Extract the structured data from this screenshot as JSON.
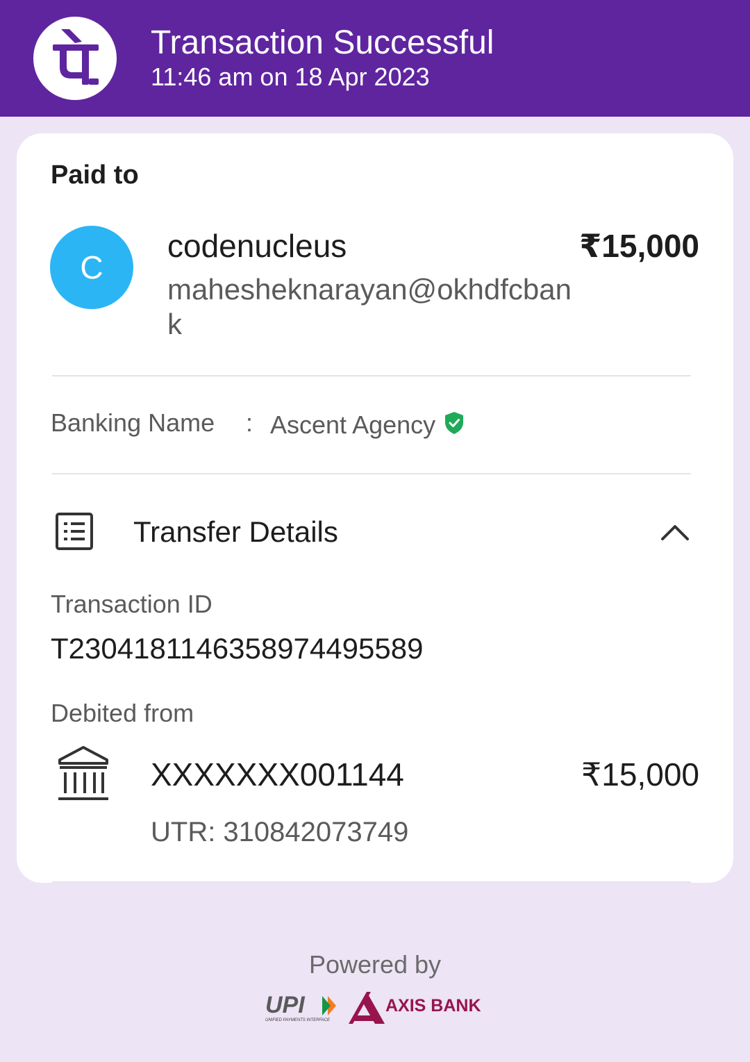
{
  "header": {
    "title": "Transaction Successful",
    "datetime": "11:46 am on 18 Apr 2023",
    "logo_icon": "phonepe-logo-icon",
    "logo_glyph": "पे",
    "bg_color": "#5f259f"
  },
  "paid_to": {
    "heading": "Paid to",
    "avatar_letter": "C",
    "avatar_color": "#2bb5f4",
    "name": "codenucleus",
    "upi_id": "maheshekn​arayan@okhdfcbank",
    "amount": "₹15,000"
  },
  "banking": {
    "label": "Banking Name",
    "separator": ":",
    "value": "Ascent Agency",
    "verified_icon": "verified-shield-icon",
    "verified_color": "#1faa59"
  },
  "transfer_details": {
    "icon": "receipt-list-icon",
    "title": "Transfer Details",
    "toggle_icon": "chevron-up-icon",
    "transaction_id_label": "Transaction ID",
    "transaction_id": "T2304181146358974495589",
    "debited_from_label": "Debited from",
    "bank_icon": "bank-icon",
    "account": "XXXXXXX001144",
    "amount": "₹15,000",
    "utr": "UTR: 310842073749"
  },
  "footer": {
    "powered_by": "Powered by",
    "upi_logo_text": "UPI",
    "upi_tagline": "UNIFIED PAYMENTS INTERFACE",
    "axis_logo_text": "AXIS BANK",
    "axis_color": "#97144d"
  }
}
